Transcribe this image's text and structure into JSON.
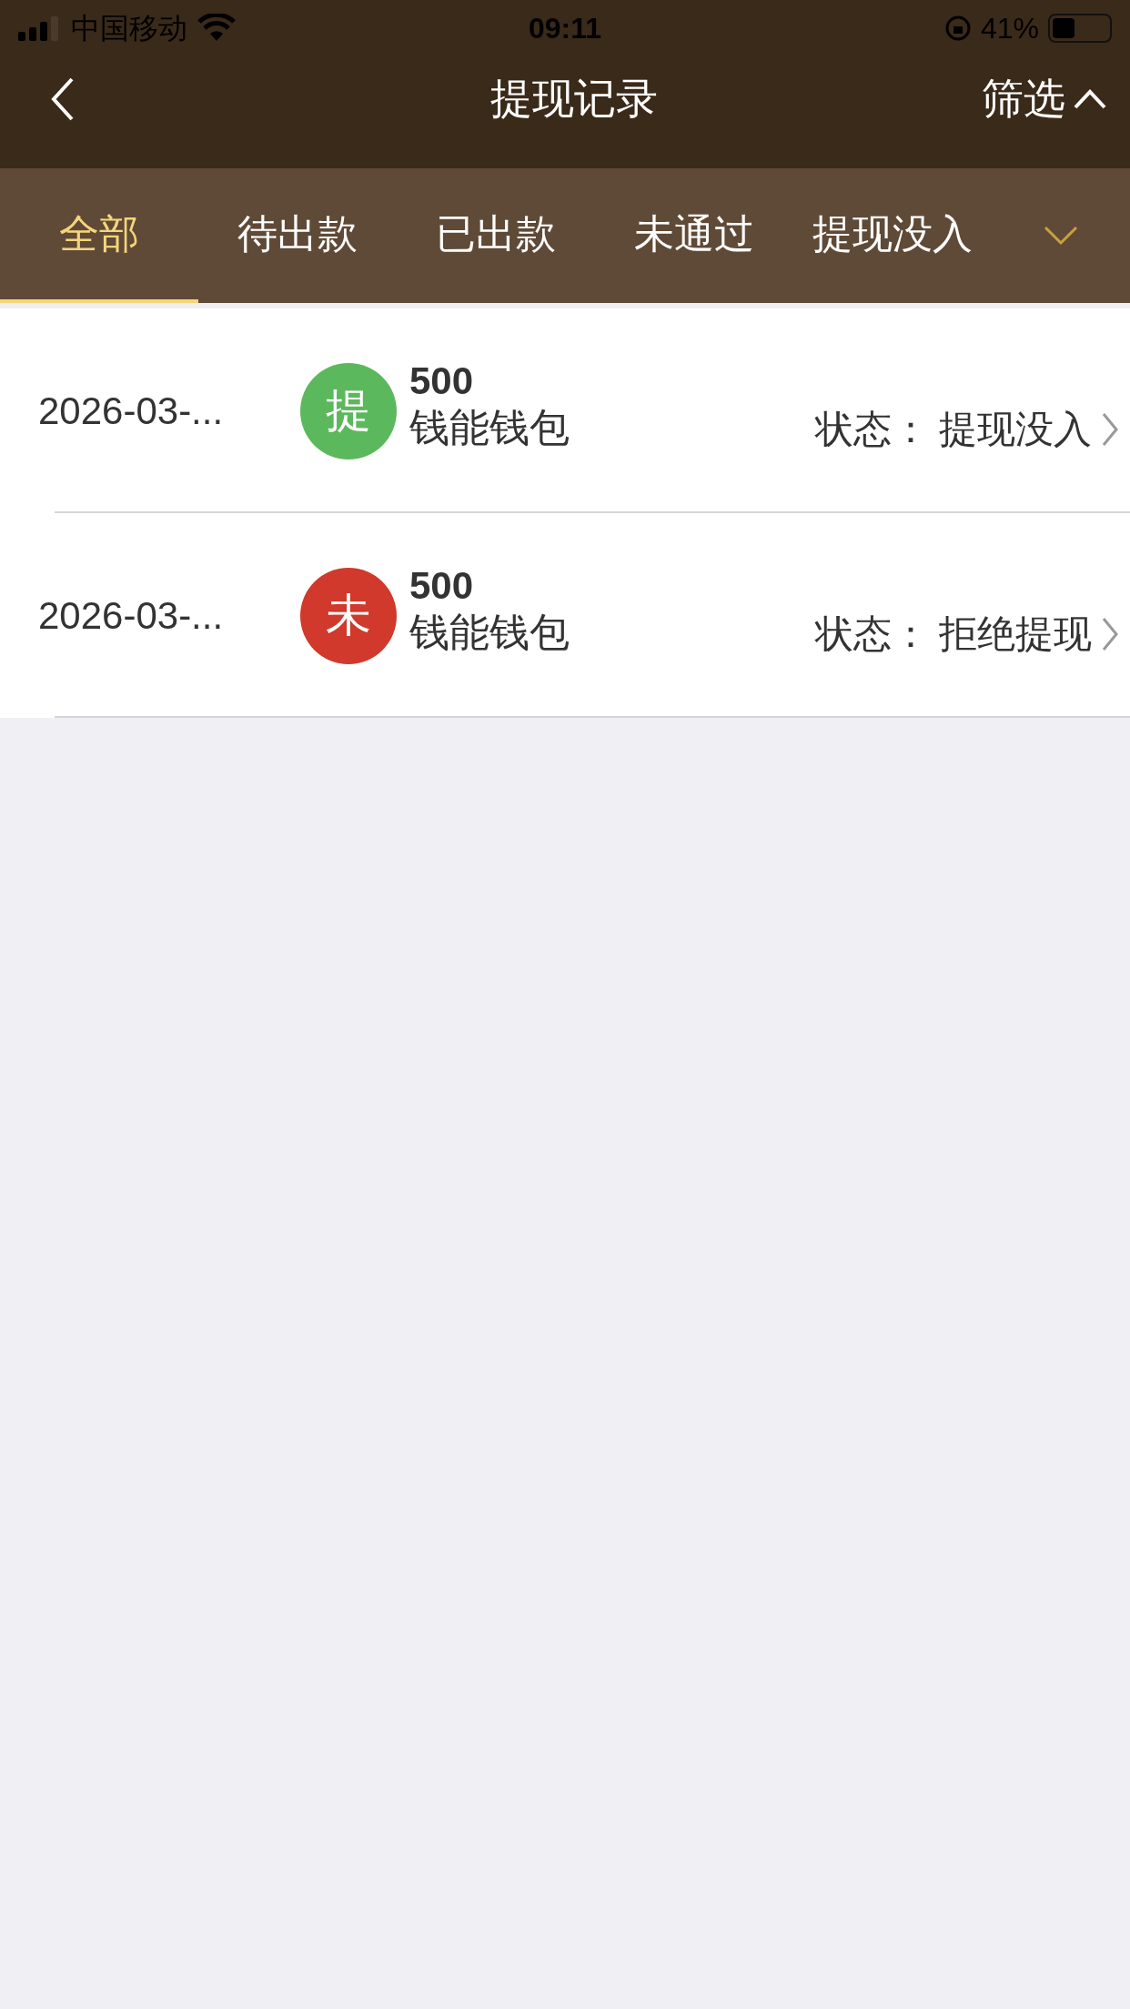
{
  "status_bar": {
    "carrier": "中国移动",
    "time": "09:11",
    "battery": "41%"
  },
  "nav": {
    "title": "提现记录",
    "filter": "筛选"
  },
  "tabs": [
    {
      "label": "全部",
      "selected": true
    },
    {
      "label": "待出款",
      "selected": false
    },
    {
      "label": "已出款",
      "selected": false
    },
    {
      "label": "未通过",
      "selected": false
    },
    {
      "label": "提现没入",
      "selected": false
    }
  ],
  "records": [
    {
      "date": "2026-03-...",
      "badge": "提",
      "color": "#5cb85c",
      "amount": "500",
      "wallet": "钱能钱包",
      "status_label": "状态：",
      "status": "提现没入"
    },
    {
      "date": "2026-03-...",
      "badge": "未",
      "color": "#d0392b",
      "amount": "500",
      "wallet": "钱能钱包",
      "status_label": "状态：",
      "status": "拒绝提现"
    }
  ]
}
